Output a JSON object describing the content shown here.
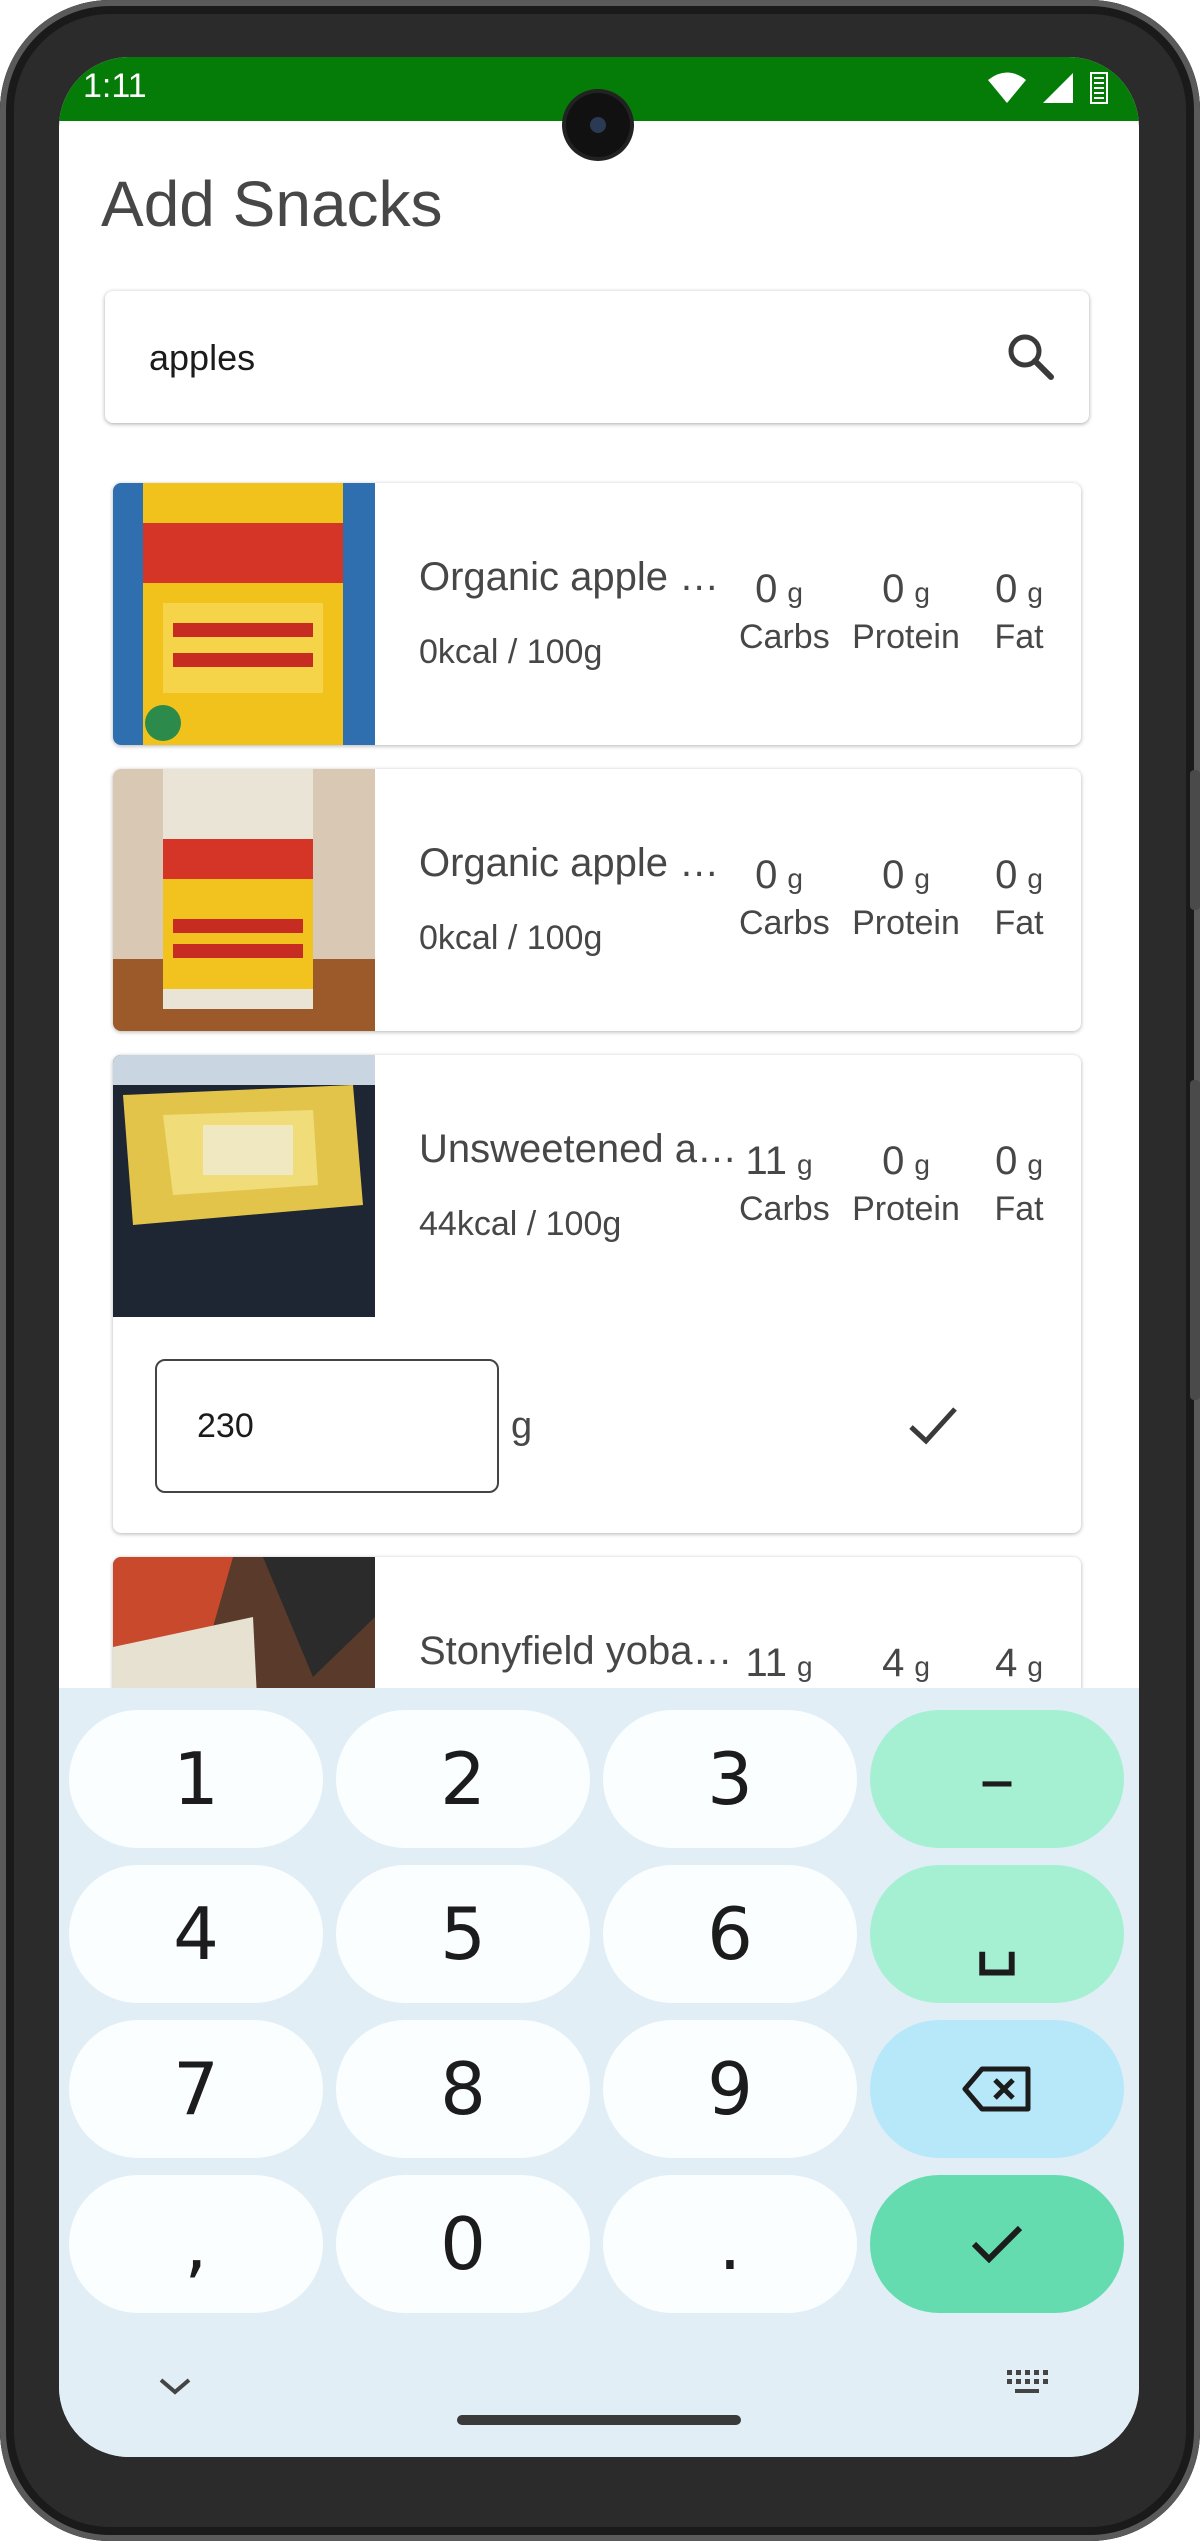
{
  "status_bar": {
    "time": "1:11"
  },
  "page": {
    "title": "Add Snacks"
  },
  "search": {
    "value": "apples"
  },
  "foods": [
    {
      "name": "Organic apple c…",
      "kcal": "0kcal / 100g",
      "carbs": "0",
      "protein": "0",
      "fat": "0"
    },
    {
      "name": "Organic apple c…",
      "kcal": "0kcal / 100g",
      "carbs": "0",
      "protein": "0",
      "fat": "0"
    },
    {
      "name": "Unsweetened a…",
      "kcal": "44kcal / 100g",
      "carbs": "11",
      "protein": "0",
      "fat": "0"
    },
    {
      "name": "Stonyfield yoba…",
      "kcal": "",
      "carbs": "11",
      "protein": "4",
      "fat": "4"
    }
  ],
  "macro_labels": {
    "carbs": "Carbs",
    "protein": "Protein",
    "fat": "Fat",
    "unit": "g"
  },
  "amount_entry": {
    "value": "230",
    "unit": "g"
  },
  "keyboard": {
    "keys": [
      "1",
      "2",
      "3",
      "–",
      "4",
      "5",
      "6",
      "␣",
      "7",
      "8",
      "9",
      "⌫",
      ",",
      "0",
      ".",
      "✓"
    ]
  },
  "colors": {
    "status_bar": "#057c08",
    "keyboard_bg": "#e2eef6",
    "key_green": "#a5f0d2",
    "key_blue": "#b7e8fa",
    "key_enter": "#64dcb0"
  }
}
